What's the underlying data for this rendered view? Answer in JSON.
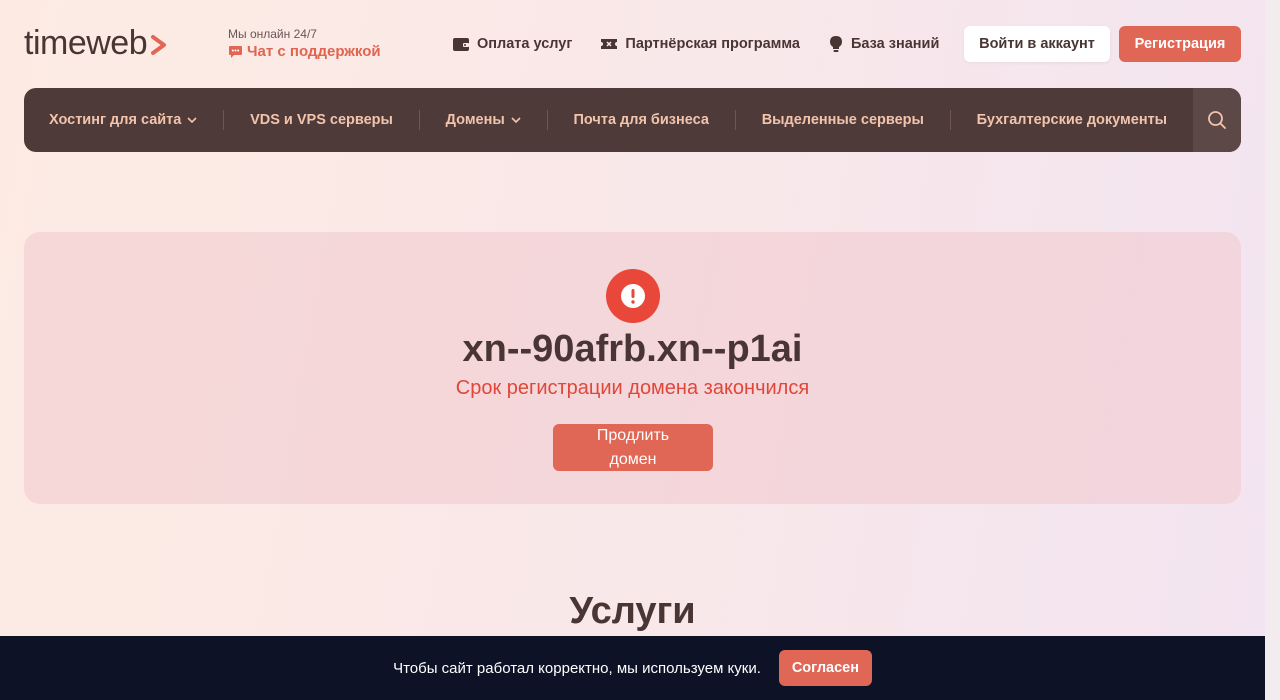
{
  "header": {
    "logo_text": "timeweb",
    "support_note": "Мы онлайн 24/7",
    "support_chat": "Чат с поддержкой",
    "links": [
      {
        "label": "Оплата услуг",
        "icon": "wallet-icon"
      },
      {
        "label": "Партнёрская программа",
        "icon": "ticket-icon"
      },
      {
        "label": "База знаний",
        "icon": "lightbulb-icon"
      }
    ],
    "login_label": "Войти в аккаунт",
    "register_label": "Регистрация"
  },
  "nav": {
    "items": [
      {
        "label": "Хостинг для сайта",
        "dropdown": true
      },
      {
        "label": "VDS и VPS серверы",
        "dropdown": false
      },
      {
        "label": "Домены",
        "dropdown": true
      },
      {
        "label": "Почта для бизнеса",
        "dropdown": false
      },
      {
        "label": "Выделенные серверы",
        "dropdown": false
      },
      {
        "label": "Бухгалтерские документы",
        "dropdown": false
      }
    ],
    "search_icon": "search-icon"
  },
  "domain_card": {
    "icon": "alert-icon",
    "domain": "xn--90afrb.xn--p1ai",
    "status": "Срок регистрации домена закончился",
    "renew_label": "Продлить домен"
  },
  "services": {
    "title": "Услуги"
  },
  "cookie": {
    "text": "Чтобы сайт работал корректно, мы используем куки.",
    "agree_label": "Согласен"
  },
  "colors": {
    "brand": "#e06755",
    "nav_bg": "#4f3a3a",
    "nav_text": "#f2c4ac",
    "alert": "#e8473a",
    "cookie_bg": "#0d1226"
  }
}
